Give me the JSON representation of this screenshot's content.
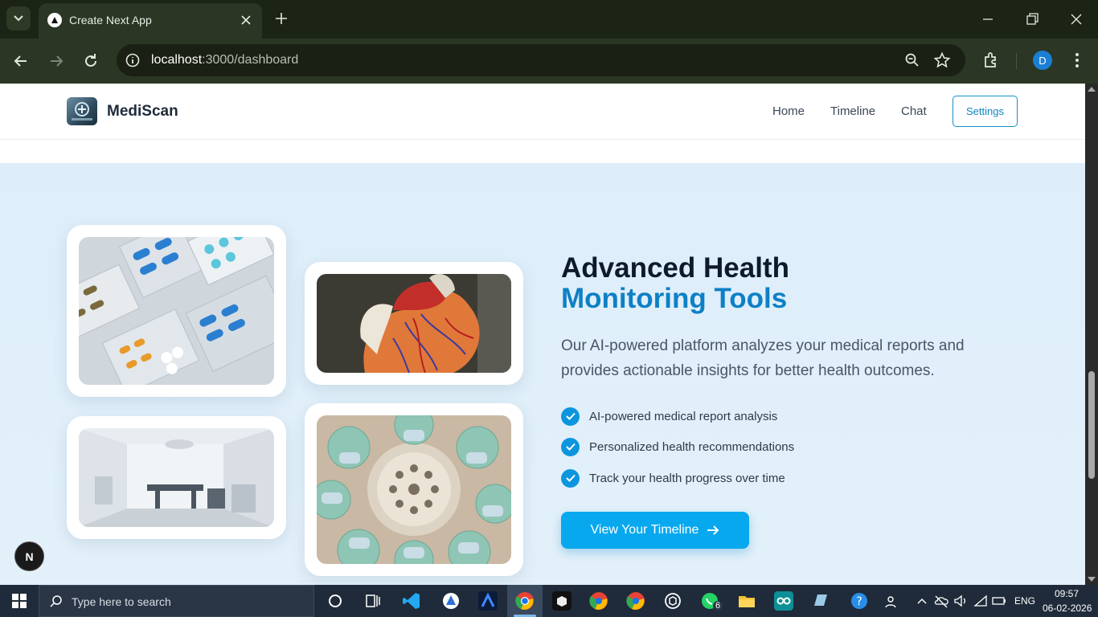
{
  "browser": {
    "tab_title": "Create Next App",
    "url_host": "localhost",
    "url_path": ":3000/dashboard",
    "profile_initial": "D"
  },
  "site": {
    "brand": "MediScan",
    "nav": [
      "Home",
      "Timeline",
      "Chat"
    ],
    "settings_label": "Settings"
  },
  "hero": {
    "title_line1": "Advanced Health",
    "title_line2": "Monitoring Tools",
    "description": "Our AI-powered platform analyzes your medical reports and provides actionable insights for better health outcomes.",
    "features": [
      "AI-powered medical report analysis",
      "Personalized health recommendations",
      "Track your health progress over time"
    ],
    "cta_label": "View Your Timeline"
  },
  "next_badge": "N",
  "taskbar": {
    "search_placeholder": "Type here to search",
    "whatsapp_badge": "6",
    "language": "ENG",
    "time": "09:57",
    "date": "06-02-2026"
  },
  "colors": {
    "accent": "#0e80c6",
    "cta": "#08a8ef",
    "hero_bg": "#ddeefa"
  }
}
